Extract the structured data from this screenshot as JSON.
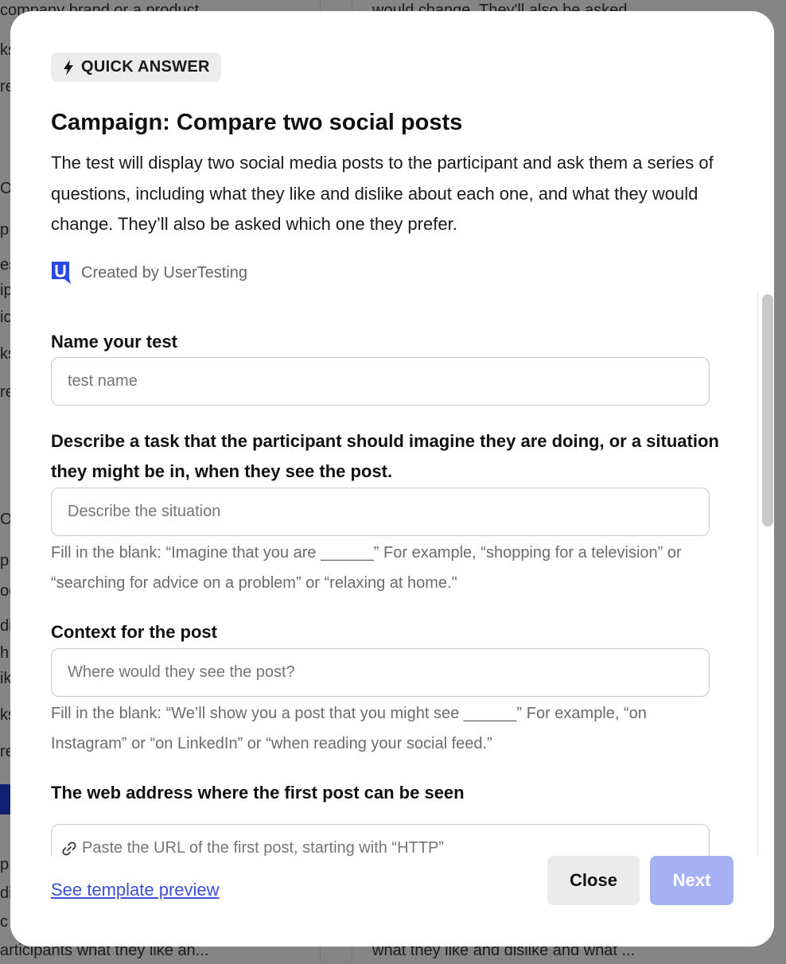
{
  "background": {
    "fragments": [
      "company brand or a product",
      "would change. They'll also be asked",
      "ks",
      "re",
      "OU",
      "p",
      "es",
      "ip",
      "ic",
      "ks",
      "re",
      "OU",
      "p",
      "oc",
      "di",
      "h",
      "ik",
      "ks",
      "re",
      "p",
      "di",
      "c",
      "articipants what they like an...",
      "what they like and dislike and what ..."
    ]
  },
  "modal": {
    "badge_label": "QUICK ANSWER",
    "badge_icon": "lightning-bolt-icon",
    "title": "Campaign: Compare two social posts",
    "description": "The test will display two social media posts to the participant and ask them a series of questions, including what they like and dislike about each one, and what they would change. They’ll also be asked which one they prefer.",
    "creator_logo": "usertesting-logo-icon",
    "creator_text": "Created by UserTesting"
  },
  "form": {
    "name_label": "Name your test",
    "name_placeholder": "test name",
    "situation_label": "Describe a task that the participant should imagine they are doing, or a situation they might be in, when they see the post.",
    "situation_placeholder": "Describe the situation",
    "situation_help": "Fill in the blank: “Imagine that you are ______” For example, “shopping for a television” or “searching for advice on a problem” or “relaxing at home.\"",
    "context_label": "Context for the post",
    "context_placeholder": "Where would they see the post?",
    "context_help": "Fill in the blank: “We’ll show you a post that you might see ______” For example, “on Instagram” or “on LinkedIn” or “when reading your social feed.”",
    "url_label": "The web address where the first post can be seen",
    "url_placeholder": "Paste the URL of the first post, starting with “HTTP”",
    "url_icon": "link-icon"
  },
  "footer": {
    "preview_link": "See template preview",
    "close_label": "Close",
    "next_label": "Next"
  },
  "colors": {
    "primary_disabled": "#a6b0f5",
    "link": "#3a4fd6",
    "badge_bg": "#ececec"
  }
}
